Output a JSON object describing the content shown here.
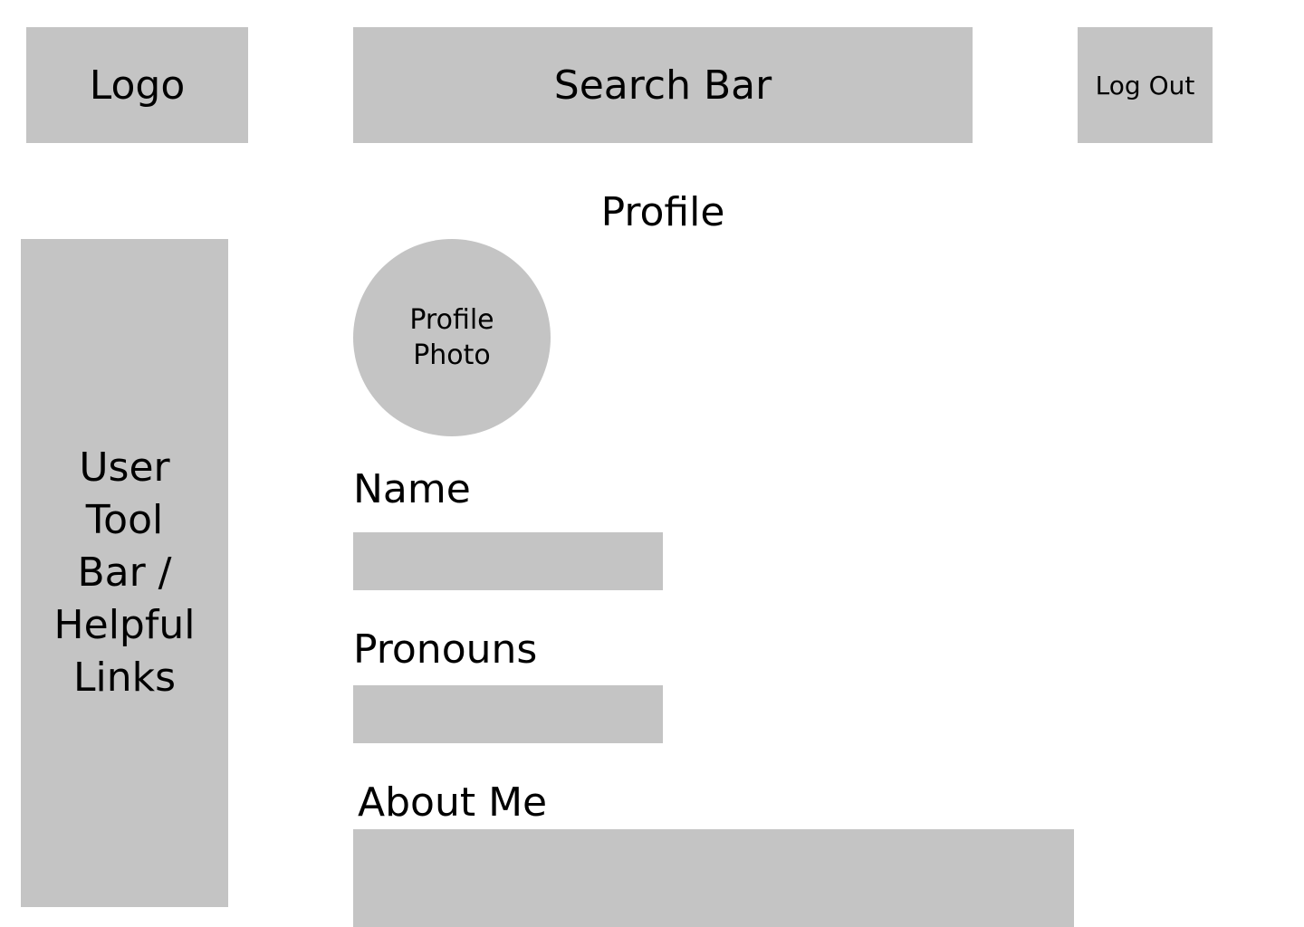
{
  "header": {
    "logo_label": "Logo",
    "search_label": "Search Bar",
    "logout_label": "Log Out"
  },
  "sidebar": {
    "label_lines": [
      "User",
      "Tool",
      "Bar /",
      "Helpful",
      "Links"
    ]
  },
  "main": {
    "title": "Profile",
    "photo_lines": [
      "Profile",
      "Photo"
    ],
    "name": {
      "label": "Name",
      "value": ""
    },
    "pronouns": {
      "label": "Pronouns",
      "value": ""
    },
    "about": {
      "label": "About Me",
      "value": ""
    }
  },
  "colors": {
    "placeholder_fill": "#c4c4c4",
    "background": "#ffffff",
    "text": "#000000"
  }
}
